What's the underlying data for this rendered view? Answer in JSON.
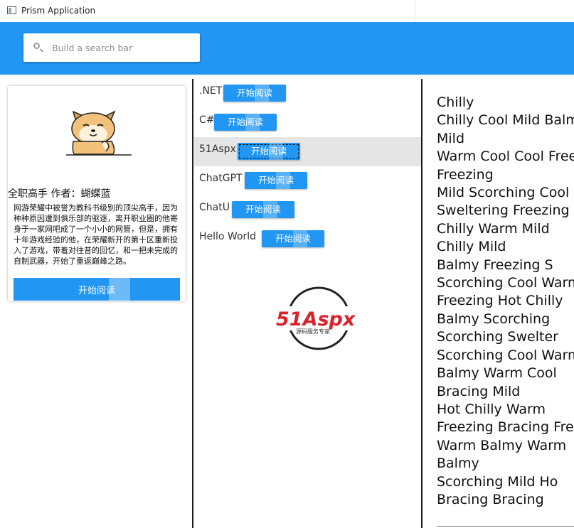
{
  "window": {
    "title": "Prism Application"
  },
  "search": {
    "placeholder": "Build a search bar",
    "value": ""
  },
  "colors": {
    "accent": "#2196F3",
    "selected_row": "#e5e5e5"
  },
  "card": {
    "title": "全职高手  作者：蝴蝶蓝",
    "description": "网游荣耀中被誉为教科书级别的顶尖高手，因为种种原因遭到俱乐部的驱逐，离开职业圈的他寄身于一家网吧成了一个小小的网管，但是，拥有十年游戏经验的他，在荣耀新开的第十区重新投入了游戏，带着对往昔的回忆，和一把未完成的自制武器，开始了重返巅峰之路。",
    "button_label": "开始阅读",
    "image_icon": "shiba-dog-illustration"
  },
  "list": {
    "items": [
      {
        "name": ".NET",
        "button": "开始阅读",
        "selected": false
      },
      {
        "name": "C#",
        "button": "开始阅读",
        "selected": false
      },
      {
        "name": "51Aspx",
        "button": "开始阅读",
        "selected": true
      },
      {
        "name": "ChatGPT",
        "button": "开始阅读",
        "selected": false
      },
      {
        "name": "ChatU",
        "button": "开始阅读",
        "selected": false
      },
      {
        "name": "Hello World",
        "button": "开始阅读",
        "selected": false
      }
    ]
  },
  "logo": {
    "brand": "51Aspx",
    "tagline": "源码服务专家"
  },
  "text_panel": {
    "lines": [
      "Chilly",
      "Chilly Cool Mild Balmy",
      "Mild",
      "Warm Cool Cool Freezing",
      "Freezing",
      "Mild Scorching Cool",
      "Sweltering Freezing",
      "Chilly  Warm  Mild",
      "Chilly Mild",
      "Balmy   Freezing   S",
      "Scorching Cool Warm",
      "Freezing Hot Chilly",
      "Balmy Scorching",
      "Scorching    Swelter",
      "Scorching Cool Warm",
      "Balmy  Warm  Cool",
      "Bracing Mild",
      "Hot  Chilly  Warm",
      "Freezing Bracing Fre",
      "Warm  Balmy  Warm",
      "Balmy",
      "Scorching  Mild  Ho",
      "Bracing Bracing"
    ]
  }
}
